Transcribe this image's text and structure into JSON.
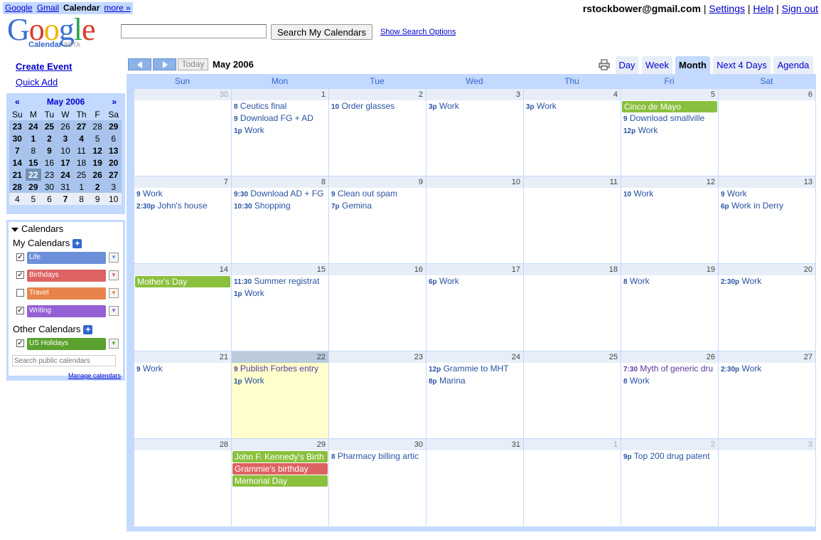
{
  "topnav": {
    "google": "Google",
    "gmail": "Gmail",
    "calendar": "Calendar",
    "more": "more »"
  },
  "user": {
    "email": "rstockbower@gmail.com",
    "settings": "Settings",
    "help": "Help",
    "signout": "Sign out"
  },
  "logo": {
    "word": "Google",
    "sub": "Calendar",
    "beta": "BETA"
  },
  "search": {
    "button": "Search My Calendars",
    "options": "Show Search Options"
  },
  "actions": {
    "create": "Create Event",
    "quick_add": "Quick Add"
  },
  "minical": {
    "prev": "«",
    "title": "May 2006",
    "next": "»",
    "dows": [
      "Su",
      "M",
      "Tu",
      "W",
      "Th",
      "F",
      "Sa"
    ],
    "weeks": [
      [
        "23",
        "24",
        "25",
        "26",
        "27",
        "28",
        "29"
      ],
      [
        "30",
        "1",
        "2",
        "3",
        "4",
        "5",
        "6"
      ],
      [
        "7",
        "8",
        "9",
        "10",
        "11",
        "12",
        "13"
      ],
      [
        "14",
        "15",
        "16",
        "17",
        "18",
        "19",
        "20"
      ],
      [
        "21",
        "22",
        "23",
        "24",
        "25",
        "26",
        "27"
      ],
      [
        "28",
        "29",
        "30",
        "31",
        "1",
        "2",
        "3"
      ],
      [
        "4",
        "5",
        "6",
        "7",
        "8",
        "9",
        "10"
      ]
    ]
  },
  "calendars": {
    "header": "Calendars",
    "my_label": "My Calendars",
    "other_label": "Other Calendars",
    "my": [
      {
        "name": "Life",
        "color": "#6b8fd8",
        "checked": true
      },
      {
        "name": "Birthdays",
        "color": "#dd6262",
        "checked": true
      },
      {
        "name": "Travel",
        "color": "#e8844b",
        "checked": false
      },
      {
        "name": "Writing",
        "color": "#9461d4",
        "checked": true
      }
    ],
    "other": [
      {
        "name": "US Holidays",
        "color": "#5ba12e",
        "checked": true
      }
    ],
    "search_placeholder": "Search public calendars",
    "manage": "Manage calendars"
  },
  "nav": {
    "today": "Today",
    "period": "May 2006"
  },
  "views": [
    "Day",
    "Week",
    "Month",
    "Next 4 Days",
    "Agenda"
  ],
  "active_view": "Month",
  "grid": {
    "dows": [
      "Sun",
      "Mon",
      "Tue",
      "Wed",
      "Thu",
      "Fri",
      "Sat"
    ],
    "weeks": [
      [
        {
          "d": "30",
          "other": true,
          "events": []
        },
        {
          "d": "1",
          "events": [
            {
              "t": "8",
              "title": "Ceutics final"
            },
            {
              "t": "9",
              "title": "Download FG + AD"
            },
            {
              "t": "1p",
              "title": "Work"
            }
          ]
        },
        {
          "d": "2",
          "events": [
            {
              "t": "10",
              "title": "Order glasses"
            }
          ]
        },
        {
          "d": "3",
          "events": [
            {
              "t": "3p",
              "title": "Work"
            }
          ]
        },
        {
          "d": "4",
          "events": [
            {
              "t": "3p",
              "title": "Work"
            }
          ]
        },
        {
          "d": "5",
          "allday": [
            {
              "title": "Cinco de Mayo",
              "color": "#8ac03d"
            }
          ],
          "events": [
            {
              "t": "9",
              "title": "Download smallville"
            },
            {
              "t": "12p",
              "title": "Work"
            }
          ]
        },
        {
          "d": "6",
          "events": []
        }
      ],
      [
        {
          "d": "7",
          "events": [
            {
              "t": "9",
              "title": "Work"
            },
            {
              "t": "2:30p",
              "title": "John's house"
            }
          ]
        },
        {
          "d": "8",
          "events": [
            {
              "t": "9:30",
              "title": "Download AD + FG"
            },
            {
              "t": "10:30",
              "title": "Shopping"
            }
          ]
        },
        {
          "d": "9",
          "events": [
            {
              "t": "9",
              "title": "Clean out spam"
            },
            {
              "t": "7p",
              "title": "Gemina"
            }
          ]
        },
        {
          "d": "10",
          "events": []
        },
        {
          "d": "11",
          "events": []
        },
        {
          "d": "12",
          "events": [
            {
              "t": "10",
              "title": "Work"
            }
          ]
        },
        {
          "d": "13",
          "events": [
            {
              "t": "9",
              "title": "Work"
            },
            {
              "t": "6p",
              "title": "Work in Derry"
            }
          ]
        }
      ],
      [
        {
          "d": "14",
          "allday": [
            {
              "title": "Mother's Day",
              "color": "#8ac03d"
            }
          ],
          "events": []
        },
        {
          "d": "15",
          "events": [
            {
              "t": "11:30",
              "title": "Summer registrat"
            },
            {
              "t": "1p",
              "title": "Work"
            }
          ]
        },
        {
          "d": "16",
          "events": []
        },
        {
          "d": "17",
          "events": [
            {
              "t": "6p",
              "title": "Work"
            }
          ]
        },
        {
          "d": "18",
          "events": []
        },
        {
          "d": "19",
          "events": [
            {
              "t": "8",
              "title": "Work"
            }
          ]
        },
        {
          "d": "20",
          "events": [
            {
              "t": "2:30p",
              "title": "Work"
            }
          ]
        }
      ],
      [
        {
          "d": "21",
          "events": [
            {
              "t": "9",
              "title": "Work"
            }
          ]
        },
        {
          "d": "22",
          "today": true,
          "events": [
            {
              "t": "9",
              "title": "Publish Forbes entry",
              "writing": true
            },
            {
              "t": "1p",
              "title": "Work"
            }
          ]
        },
        {
          "d": "23",
          "events": []
        },
        {
          "d": "24",
          "events": [
            {
              "t": "12p",
              "title": "Grammie to MHT"
            },
            {
              "t": "8p",
              "title": "Marina"
            }
          ]
        },
        {
          "d": "25",
          "events": []
        },
        {
          "d": "26",
          "events": [
            {
              "t": "7:30",
              "title": "Myth of generic dru",
              "writing": true
            },
            {
              "t": "8",
              "title": "Work"
            }
          ]
        },
        {
          "d": "27",
          "events": [
            {
              "t": "2:30p",
              "title": "Work"
            }
          ]
        }
      ],
      [
        {
          "d": "28",
          "events": []
        },
        {
          "d": "29",
          "allday": [
            {
              "title": "John F. Kennedy's Birth",
              "color": "#8ac03d"
            },
            {
              "title": "Grammie's birthday",
              "color": "#dd6262"
            },
            {
              "title": "Memorial Day",
              "color": "#8ac03d"
            }
          ],
          "events": []
        },
        {
          "d": "30",
          "events": [
            {
              "t": "8",
              "title": "Pharmacy billing artic"
            }
          ]
        },
        {
          "d": "31",
          "events": []
        },
        {
          "d": "1",
          "other": true,
          "events": []
        },
        {
          "d": "2",
          "other": true,
          "events": [
            {
              "t": "9p",
              "title": "Top 200 drug patent"
            }
          ]
        },
        {
          "d": "3",
          "other": true,
          "events": []
        }
      ]
    ]
  }
}
